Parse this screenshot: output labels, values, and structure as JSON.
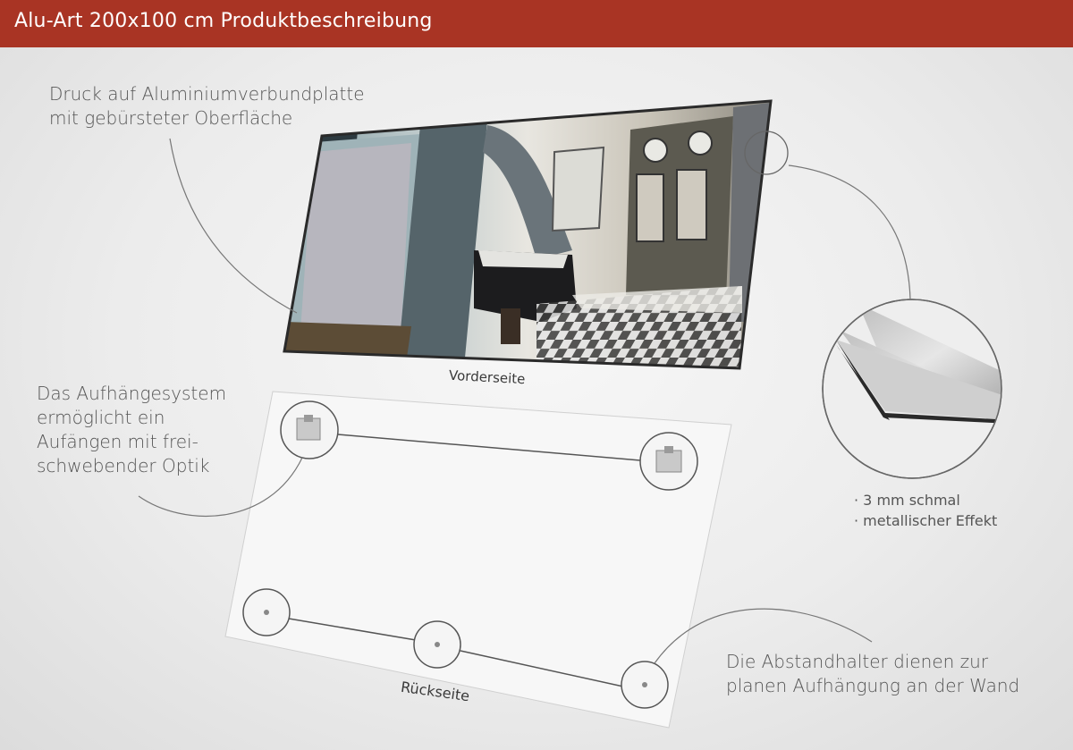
{
  "header": {
    "title": "Alu-Art 200x100 cm Produktbeschreibung"
  },
  "callouts": {
    "print": [
      "Druck auf Aluminiumverbundplatte",
      "mit gebürsteter Oberfläche"
    ],
    "hanging": [
      "Das Aufhängesystem",
      "ermöglicht ein",
      "Aufängen mit frei-",
      "schwebender Optik"
    ],
    "spacers": [
      "Die Abstandhalter dienen zur",
      "planen Aufhängung an der Wand"
    ]
  },
  "labels": {
    "front": "Vorderseite",
    "back": "Rückseite"
  },
  "features": [
    "· 3 mm schmal",
    "· metallischer Effekt"
  ],
  "colors": {
    "header": "#a93424",
    "text": "#555555"
  }
}
